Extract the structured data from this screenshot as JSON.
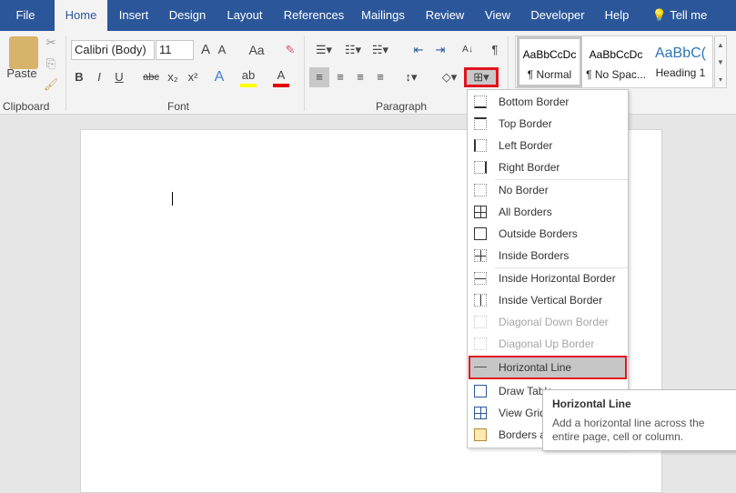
{
  "tabs": [
    "File",
    "Home",
    "Insert",
    "Design",
    "Layout",
    "References",
    "Mailings",
    "Review",
    "View",
    "Developer",
    "Help",
    "Tell me"
  ],
  "clipboard": {
    "paste": "Paste",
    "label": "Clipboard"
  },
  "font": {
    "name": "Calibri (Body)",
    "size": "11",
    "label": "Font",
    "grow": "A",
    "shrink": "A",
    "case": "Aa",
    "bold": "B",
    "italic": "I",
    "underline": "U",
    "strike": "abc",
    "sub": "x₂",
    "sup": "x²",
    "effects": "A",
    "highlight": "ab",
    "color": "A"
  },
  "paragraph": {
    "label": "Paragraph",
    "pilcrow": "¶",
    "sort": "A↓"
  },
  "styles": [
    {
      "preview": "AaBbCcDc",
      "name": "¶ Normal"
    },
    {
      "preview": "AaBbCcDc",
      "name": "¶ No Spac..."
    },
    {
      "preview": "AaBbC(",
      "name": "Heading 1"
    }
  ],
  "menu": [
    "Bottom Border",
    "Top Border",
    "Left Border",
    "Right Border",
    "No Border",
    "All Borders",
    "Outside Borders",
    "Inside Borders",
    "Inside Horizontal Border",
    "Inside Vertical Border",
    "Diagonal Down Border",
    "Diagonal Up Border",
    "Horizontal Line",
    "Draw Table",
    "View Gridlines",
    "Borders and Shading..."
  ],
  "tooltip": {
    "title": "Horizontal Line",
    "body": "Add a horizontal line across the entire page, cell or column."
  },
  "colors": {
    "accent": "#2b579a",
    "highlight_box": "#e0141e"
  }
}
